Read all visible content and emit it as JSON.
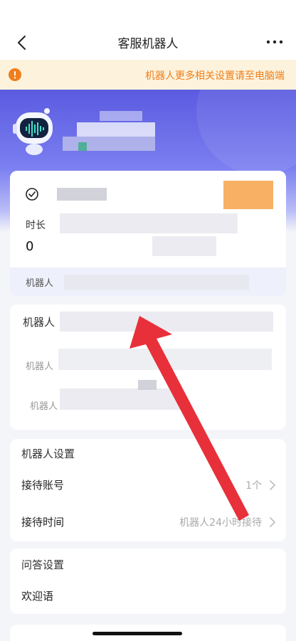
{
  "nav": {
    "title": "客服机器人",
    "back_icon": "chevron-left-icon",
    "more_icon": "more-dots-icon"
  },
  "notice": {
    "icon": "warning-circle-icon",
    "text": "机器人更多相关设置请至电脑端"
  },
  "stats_card": {
    "duration_label": "时长",
    "duration_value": "0",
    "footer_label": "机器人"
  },
  "robot_card": {
    "title": "机器人",
    "row1_label": "机器人",
    "row2_label": "机器人"
  },
  "robot_settings": {
    "title": "机器人设置",
    "rows": [
      {
        "label": "接待账号",
        "value": "1个"
      },
      {
        "label": "接待时间",
        "value": "机器人24小时接待"
      }
    ]
  },
  "qa_settings": {
    "title": "问答设置",
    "rows": [
      {
        "label": "欢迎语"
      }
    ]
  },
  "colors": {
    "accent": "#5a5be0",
    "notice_bg": "#fdf3dc",
    "notice_text": "#f07e1a",
    "arrow": "#e8303a"
  }
}
